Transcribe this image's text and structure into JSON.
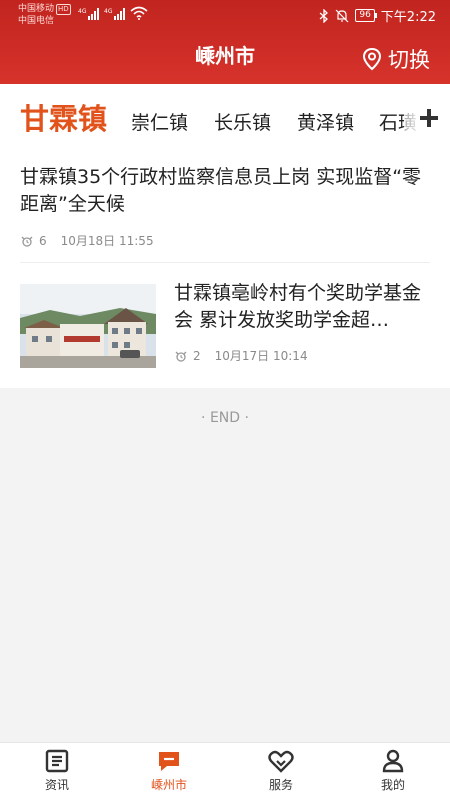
{
  "status_bar": {
    "carrier1": "中国移动",
    "hd": "HD",
    "carrier2": "中国电信",
    "net1": "4G",
    "net2": "4G",
    "battery": "96",
    "time": "下午2:22"
  },
  "header": {
    "title": "嵊州市",
    "switch_label": "切换",
    "accent": "#d12f28"
  },
  "tabs": [
    {
      "label": "甘霖镇",
      "active": true
    },
    {
      "label": "崇仁镇",
      "active": false
    },
    {
      "label": "长乐镇",
      "active": false
    },
    {
      "label": "黄泽镇",
      "active": false
    },
    {
      "label": "石璜",
      "active": false
    }
  ],
  "news": [
    {
      "title": "甘霖镇35个行政村监察信息员上岗 实现监督“零距离”全天候",
      "views": "6",
      "time": "10月18日 11:55"
    },
    {
      "title": "甘霖镇亳岭村有个奖助学基金会 累计发放奖助学金超…",
      "views": "2",
      "time": "10月17日 10:14"
    }
  ],
  "end_text": "· END ·",
  "nav": [
    {
      "label": "资讯",
      "icon": "news-icon",
      "active": false
    },
    {
      "label": "嵊州市",
      "icon": "chat-icon",
      "active": true
    },
    {
      "label": "服务",
      "icon": "service-icon",
      "active": false
    },
    {
      "label": "我的",
      "icon": "profile-icon",
      "active": false
    }
  ]
}
